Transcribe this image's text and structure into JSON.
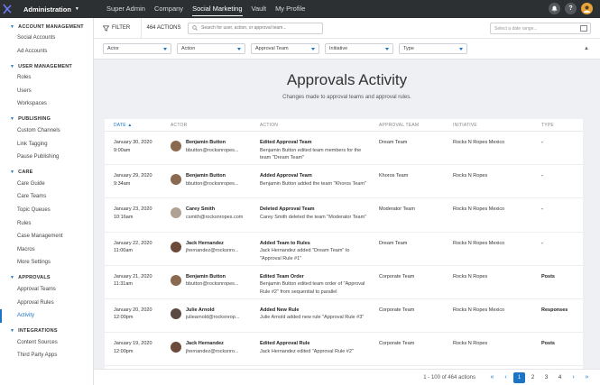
{
  "topbar": {
    "app_name": "Administration",
    "nav": [
      "Super Admin",
      "Company",
      "Social Marketing",
      "Vault",
      "My Profile"
    ],
    "help": "?"
  },
  "sidebar": [
    {
      "section": "ACCOUNT MANAGEMENT",
      "items": [
        "Social Accounts",
        "Ad Accounts"
      ]
    },
    {
      "section": "USER MANAGEMENT",
      "items": [
        "Roles",
        "Users",
        "Workspaces"
      ]
    },
    {
      "section": "PUBLISHING",
      "items": [
        "Custom Channels",
        "Link Tagging",
        "Pause Publishing"
      ]
    },
    {
      "section": "CARE",
      "items": [
        "Care Guide",
        "Care Teams",
        "Topic Queues",
        "Rules",
        "Case Management",
        "Macros",
        "More Settings"
      ]
    },
    {
      "section": "APPROVALS",
      "items": [
        "Approval Teams",
        "Approval Rules",
        "Activity"
      ]
    },
    {
      "section": "INTEGRATIONS",
      "items": [
        "Content Sources",
        "Third Party Apps"
      ]
    }
  ],
  "filterbar": {
    "filter_label": "FILTER",
    "count": "464 ACTIONS",
    "search_placeholder": "Search for user, action, or approval team...",
    "date_placeholder": "Select a date range..."
  },
  "selects": [
    "Actor",
    "Action",
    "Approval Team",
    "Initiative",
    "Type"
  ],
  "page": {
    "title": "Approvals Activity",
    "subtitle": "Changes made to approval teams and approval rules."
  },
  "table": {
    "headers": [
      "DATE",
      "ACTOR",
      "ACTION",
      "APPROVAL TEAM",
      "INITIATIVE",
      "TYPE"
    ],
    "rows": [
      {
        "date": "January 30, 2020",
        "time": "9:00am",
        "actor": "Benjamin Button",
        "email": "bbutton@rocksnropes...",
        "action": "Edited Approval Team",
        "detail": "Benjamin Button edited team members for the team \"Dream Team\"",
        "team": "Dream Team",
        "initiative": "Rocks N Ropes Mexico",
        "type": "-",
        "avatar": "#8a6a4e"
      },
      {
        "date": "January 29, 2020",
        "time": "9:34am",
        "actor": "Benjamin Button",
        "email": "bbutton@rocksnropes...",
        "action": "Added Approval Team",
        "detail": "Benjamin Button added the team \"Khoros Team\"",
        "team": "Khoros Team",
        "initiative": "Rocks N Ropes",
        "type": "-",
        "avatar": "#8a6a4e"
      },
      {
        "date": "January 23, 2020",
        "time": "10:16am",
        "actor": "Carey Smith",
        "email": "csmith@rocksnropes.com",
        "action": "Deleted Approval Team",
        "detail": "Carey Smith deleted the team \"Moderator Team\"",
        "team": "Moderator Team",
        "initiative": "Rocks N Ropes Mexico",
        "type": "-",
        "avatar": "#b0a293"
      },
      {
        "date": "January 22, 2020",
        "time": "11:00am",
        "actor": "Jack Hernandez",
        "email": "jhernandez@rocksnro...",
        "action": "Added Team to Rules",
        "detail": "Jack Hernandez added \"Dream Team\" to \"Approval Rule #1\"",
        "team": "Dream Team",
        "initiative": "Rocks N Ropes Mexico",
        "type": "-",
        "avatar": "#6b4a3a"
      },
      {
        "date": "January 21, 2020",
        "time": "11:31am",
        "actor": "Benjamin Button",
        "email": "bbutton@rocksnropes...",
        "action": "Edited Team Order",
        "detail": "Benjamin Button edited team order of \"Approval Rule #2\" from sequential to parallel",
        "team": "Corporate Team",
        "initiative": "Rocks N Ropes",
        "type": "Posts",
        "avatar": "#8a6a4e"
      },
      {
        "date": "January 20, 2020",
        "time": "12:00pm",
        "actor": "Julie Arnold",
        "email": "juliearnold@rocksnrop...",
        "action": "Added New Rule",
        "detail": "Julie Arnold added new rule \"Approval Rule #3\"",
        "team": "Corporate Team",
        "initiative": "Rocks N Ropes Mexico",
        "type": "Responses",
        "avatar": "#5a4a42"
      },
      {
        "date": "January 19, 2020",
        "time": "12:00pm",
        "actor": "Jack Hernandez",
        "email": "jhernandez@rocksnro...",
        "action": "Edited Approval Rule",
        "detail": "Jack Hernandez edited \"Approval Rule #2\"",
        "team": "Corporate Team",
        "initiative": "Rocks N Ropes",
        "type": "Posts",
        "avatar": "#6b4a3a"
      }
    ]
  },
  "pagination": {
    "summary": "1 - 100 of 464 actions",
    "pages": [
      "1",
      "2",
      "3",
      "4"
    ],
    "current": "1",
    "first": "«",
    "prev": "‹",
    "next": "›",
    "last": "»"
  }
}
